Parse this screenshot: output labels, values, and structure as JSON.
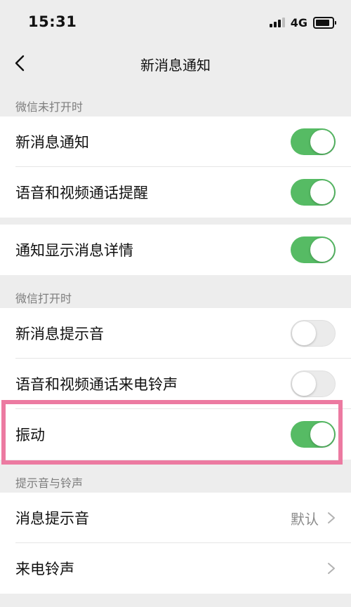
{
  "status_bar": {
    "time": "15:31",
    "network": "4G"
  },
  "nav": {
    "title": "新消息通知",
    "back_icon": "chevron-left-icon"
  },
  "sections": {
    "closed_label": "微信未打开时",
    "open_label": "微信打开时",
    "sounds_label": "提示音与铃声"
  },
  "rows": {
    "new_message_notify": {
      "label": "新消息通知",
      "on": true
    },
    "voice_video_reminder": {
      "label": "语音和视频通话提醒",
      "on": true
    },
    "show_details": {
      "label": "通知显示消息详情",
      "on": true
    },
    "new_message_sound": {
      "label": "新消息提示音",
      "on": false
    },
    "voice_video_ringtone": {
      "label": "语音和视频通话来电铃声",
      "on": false
    },
    "vibration": {
      "label": "振动",
      "on": true
    },
    "message_tone": {
      "label": "消息提示音",
      "value": "默认"
    },
    "incoming_ringtone": {
      "label": "来电铃声"
    }
  },
  "colors": {
    "switch_on": "#56bb64",
    "switch_off": "#ebebeb",
    "highlight": "#ec7aa1",
    "background": "#ededed"
  }
}
